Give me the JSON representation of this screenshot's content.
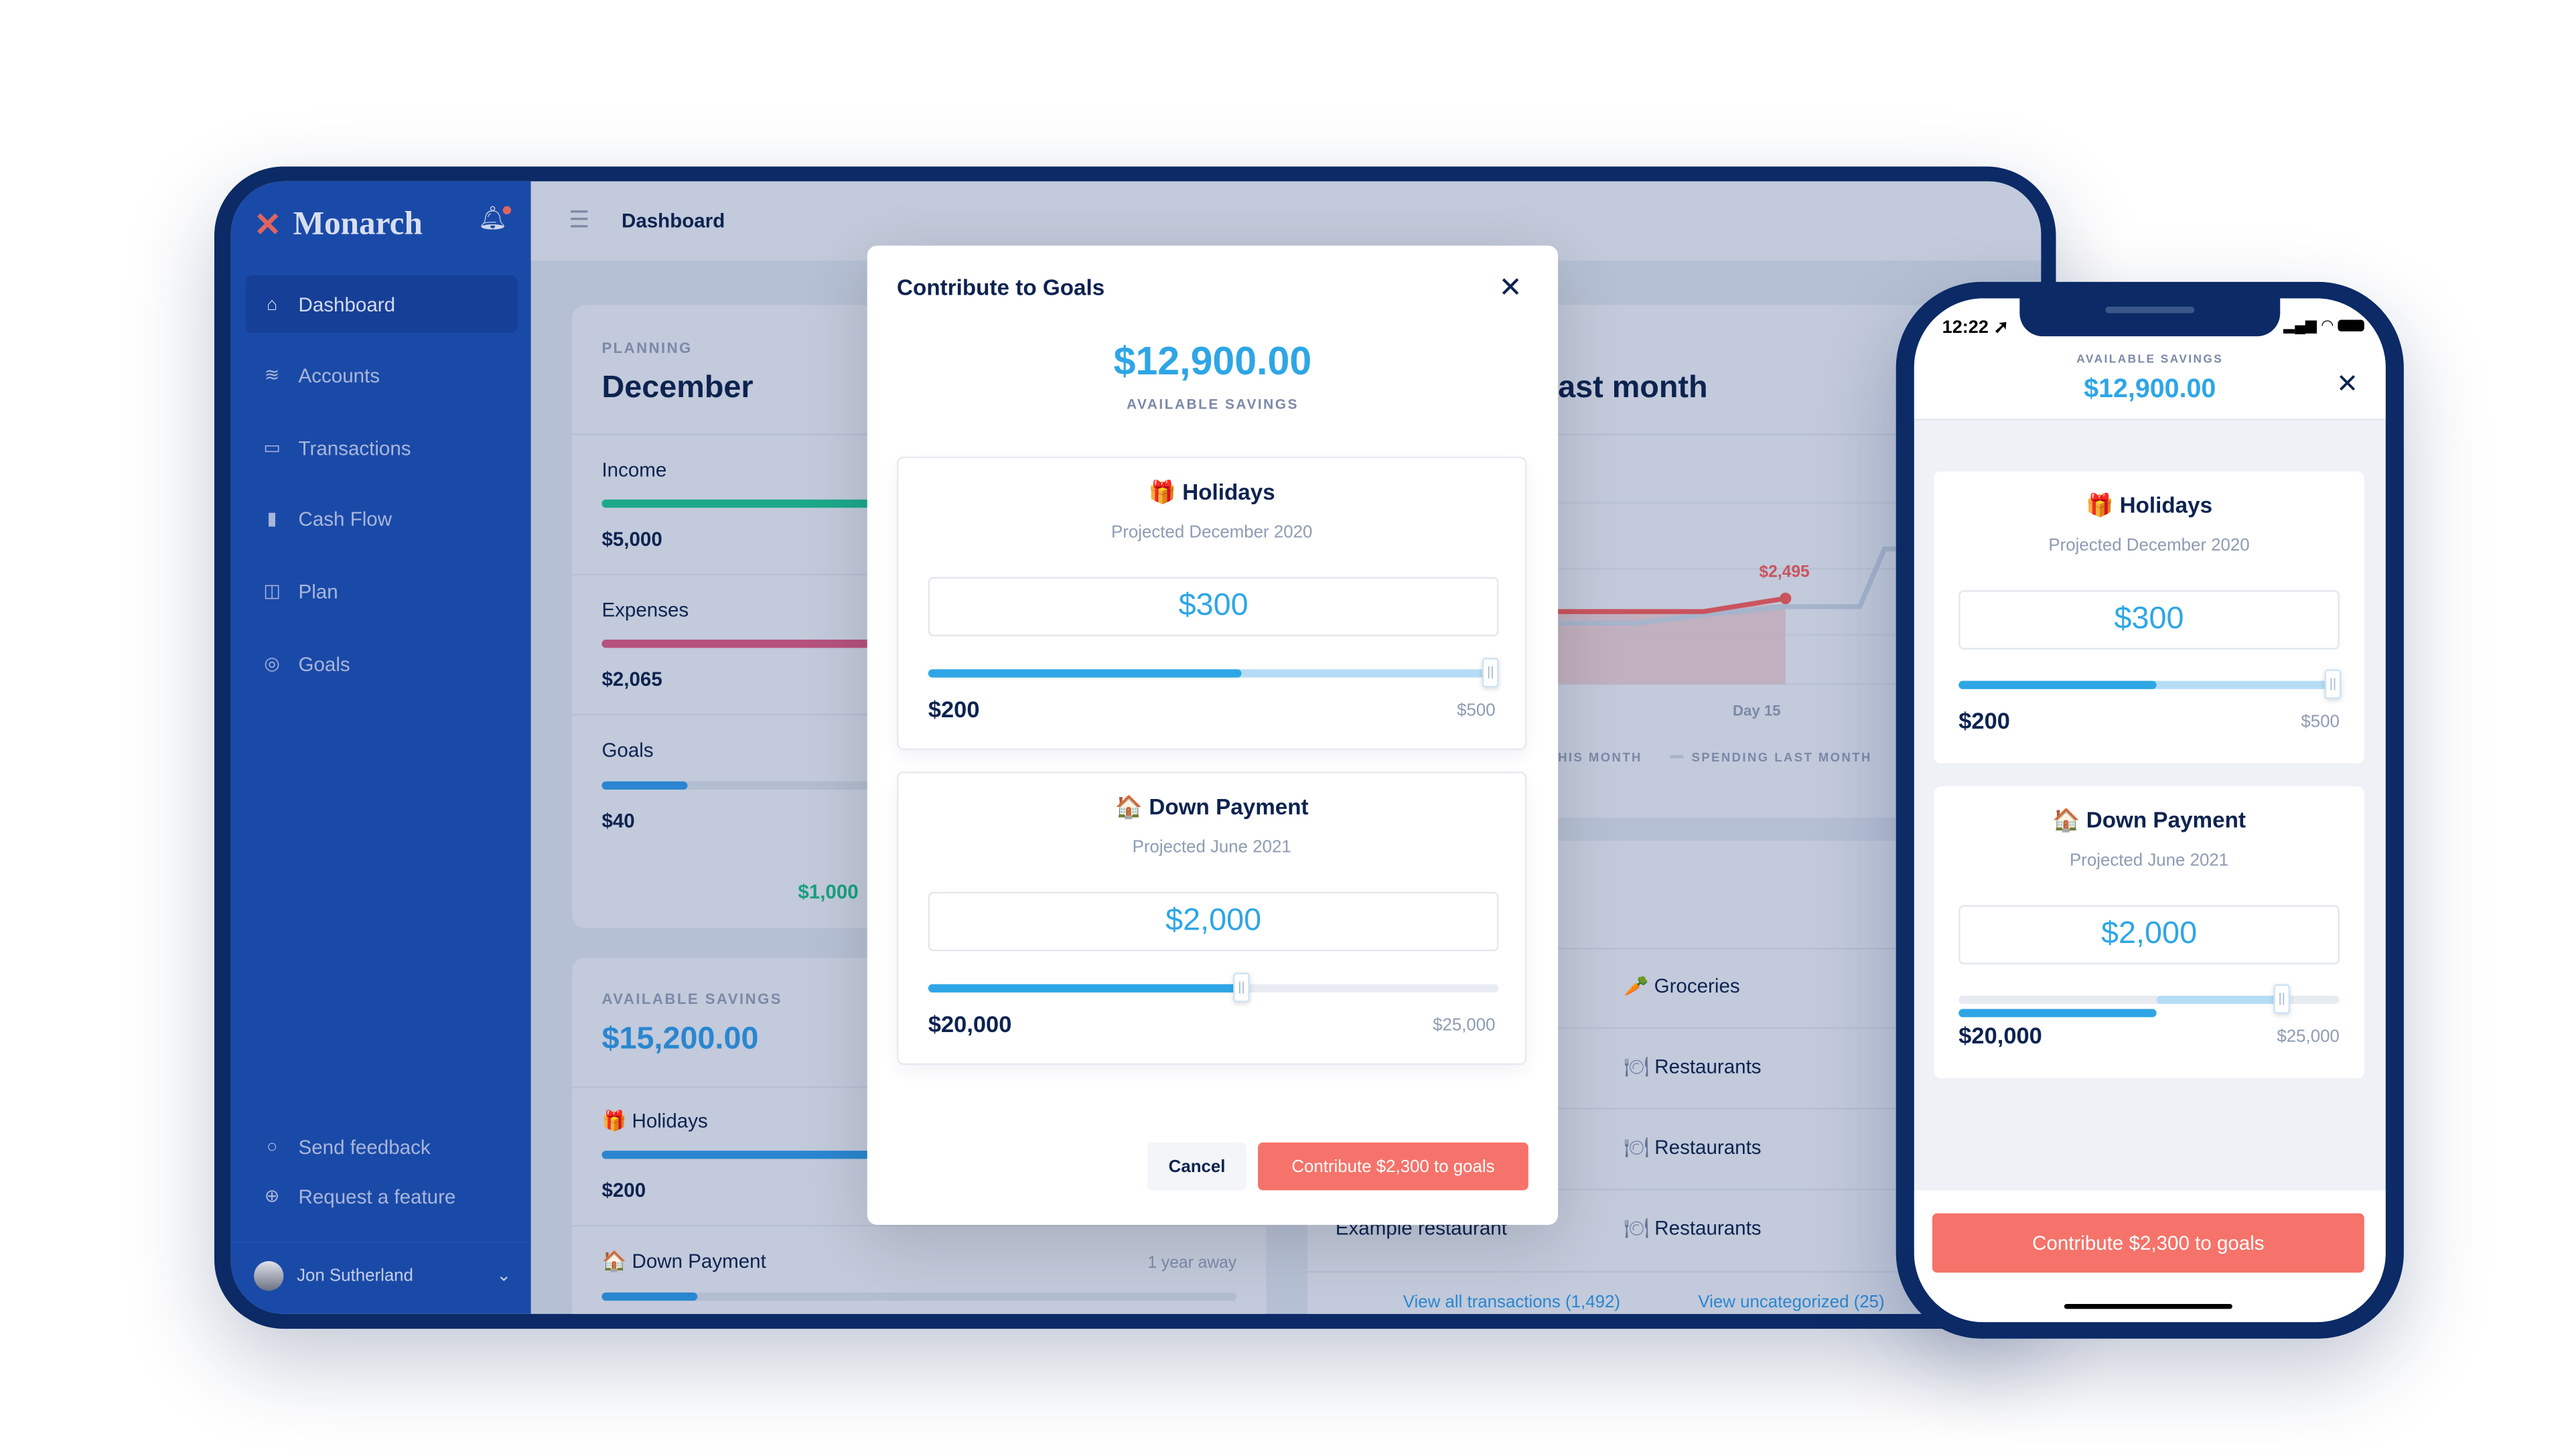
{
  "app": {
    "name": "Monarch",
    "page_title": "Dashboard"
  },
  "sidebar": {
    "items": [
      {
        "label": "Dashboard",
        "icon": "home-icon"
      },
      {
        "label": "Accounts",
        "icon": "layers-icon"
      },
      {
        "label": "Transactions",
        "icon": "credit-card-icon"
      },
      {
        "label": "Cash Flow",
        "icon": "bar-chart-icon"
      },
      {
        "label": "Plan",
        "icon": "map-icon"
      },
      {
        "label": "Goals",
        "icon": "target-icon"
      }
    ],
    "send_feedback": "Send feedback",
    "request_feature": "Request a feature",
    "user_name": "Jon Sutherland"
  },
  "planning": {
    "label": "PLANNING",
    "month": "December",
    "income_label": "Income",
    "income_value": "$5,000",
    "income_progress": 1.0,
    "expenses_label": "Expenses",
    "expenses_value": "$2,065",
    "expenses_progress": 1.0,
    "goals_label": "Goals",
    "goals_value": "$40",
    "goals_target": "$1,000",
    "goals_progress": 0.04
  },
  "savings": {
    "label": "AVAILABLE SAVINGS",
    "amount": "$15,200.00",
    "goals": [
      {
        "emoji": "🎁",
        "name": "Holidays",
        "value": "$200"
      },
      {
        "emoji": "🏠",
        "name": "Down Payment",
        "eta": "1 year away"
      }
    ]
  },
  "spending": {
    "title_fragment": "ast month",
    "current_label": "$2,495",
    "x_label": "Day 15",
    "legend_this": "HIS MONTH",
    "legend_last": "SPENDING LAST MONTH",
    "colors": {
      "this_month": "#c9545e",
      "last_month": "#a6b4cc"
    }
  },
  "transactions": {
    "rows": [
      {
        "merchant": "",
        "category": "Groceries",
        "emoji": "🥕"
      },
      {
        "merchant": "",
        "category": "Restaurants",
        "emoji": "🍽"
      },
      {
        "merchant": "",
        "category": "Restaurants",
        "emoji": "🍽"
      },
      {
        "merchant": "Example restaurant",
        "category": "Restaurants",
        "emoji": "🍽"
      }
    ],
    "view_all": "View all transactions (1,492)",
    "view_uncategorized": "View uncategorized (25)"
  },
  "modal": {
    "title": "Contribute to Goals",
    "available_amount": "$12,900.00",
    "available_label": "AVAILABLE SAVINGS",
    "goals": [
      {
        "emoji": "🎁",
        "name": "Holidays",
        "projected": "Projected December 2020",
        "contribution": "$300",
        "current": "$200",
        "target": "$500",
        "current_fraction": 0.4,
        "after_fraction": 1.0
      },
      {
        "emoji": "🏠",
        "name": "Down Payment",
        "projected": "Projected June 2021",
        "contribution": "$2,000",
        "current": "$20,000",
        "target": "$25,000",
        "current_fraction": 0.55,
        "after_fraction": 0.55
      }
    ],
    "cancel": "Cancel",
    "submit": "Contribute $2,300 to goals"
  },
  "phone": {
    "time": "12:22",
    "available_label": "AVAILABLE SAVINGS",
    "available_amount": "$12,900.00",
    "submit": "Contribute $2,300 to goals"
  },
  "colors": {
    "accent": "#2ea6e6",
    "coral": "#f5736a",
    "navy": "#0d2350",
    "sidebar": "#1a4aa8",
    "frame": "#0b2a66"
  }
}
